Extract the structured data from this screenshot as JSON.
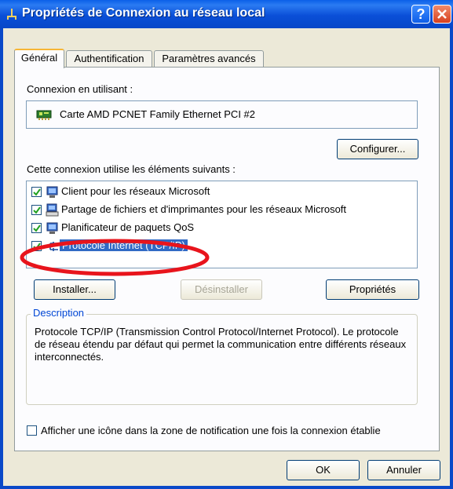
{
  "window": {
    "title": "Propriétés de Connexion au réseau local",
    "help_label": "?"
  },
  "tabs": [
    {
      "label": "Général",
      "active": true
    },
    {
      "label": "Authentification",
      "active": false
    },
    {
      "label": "Paramètres avancés",
      "active": false
    }
  ],
  "connection": {
    "label": "Connexion en utilisant :",
    "adapter": "Carte AMD PCNET Family Ethernet PCI #2",
    "configure_label": "Configurer..."
  },
  "components": {
    "label": "Cette connexion utilise les éléments suivants :",
    "items": [
      {
        "label": "Client pour les réseaux Microsoft",
        "checked": true,
        "icon": "network-client-icon",
        "selected": false
      },
      {
        "label": "Partage de fichiers et d'imprimantes pour les réseaux Microsoft",
        "checked": true,
        "icon": "file-printer-sharing-icon",
        "selected": false
      },
      {
        "label": "Planificateur de paquets QoS",
        "checked": true,
        "icon": "qos-scheduler-icon",
        "selected": false
      },
      {
        "label": "Protocole Internet (TCP/IP)",
        "checked": true,
        "icon": "protocol-icon",
        "selected": true
      }
    ],
    "install_label": "Installer...",
    "uninstall_label": "Désinstaller",
    "properties_label": "Propriétés"
  },
  "description": {
    "legend": "Description",
    "text": "Protocole TCP/IP (Transmission Control Protocol/Internet Protocol). Le protocole de réseau étendu par défaut qui permet la communication entre différents réseaux interconnectés."
  },
  "notify": {
    "label": "Afficher une icône dans la zone de notification une fois la connexion établie",
    "checked": false
  },
  "footer": {
    "ok_label": "OK",
    "cancel_label": "Annuler"
  },
  "colors": {
    "title_bar": "#0a4fd8",
    "selection": "#316ac5",
    "annotation_red": "#e8141c"
  }
}
